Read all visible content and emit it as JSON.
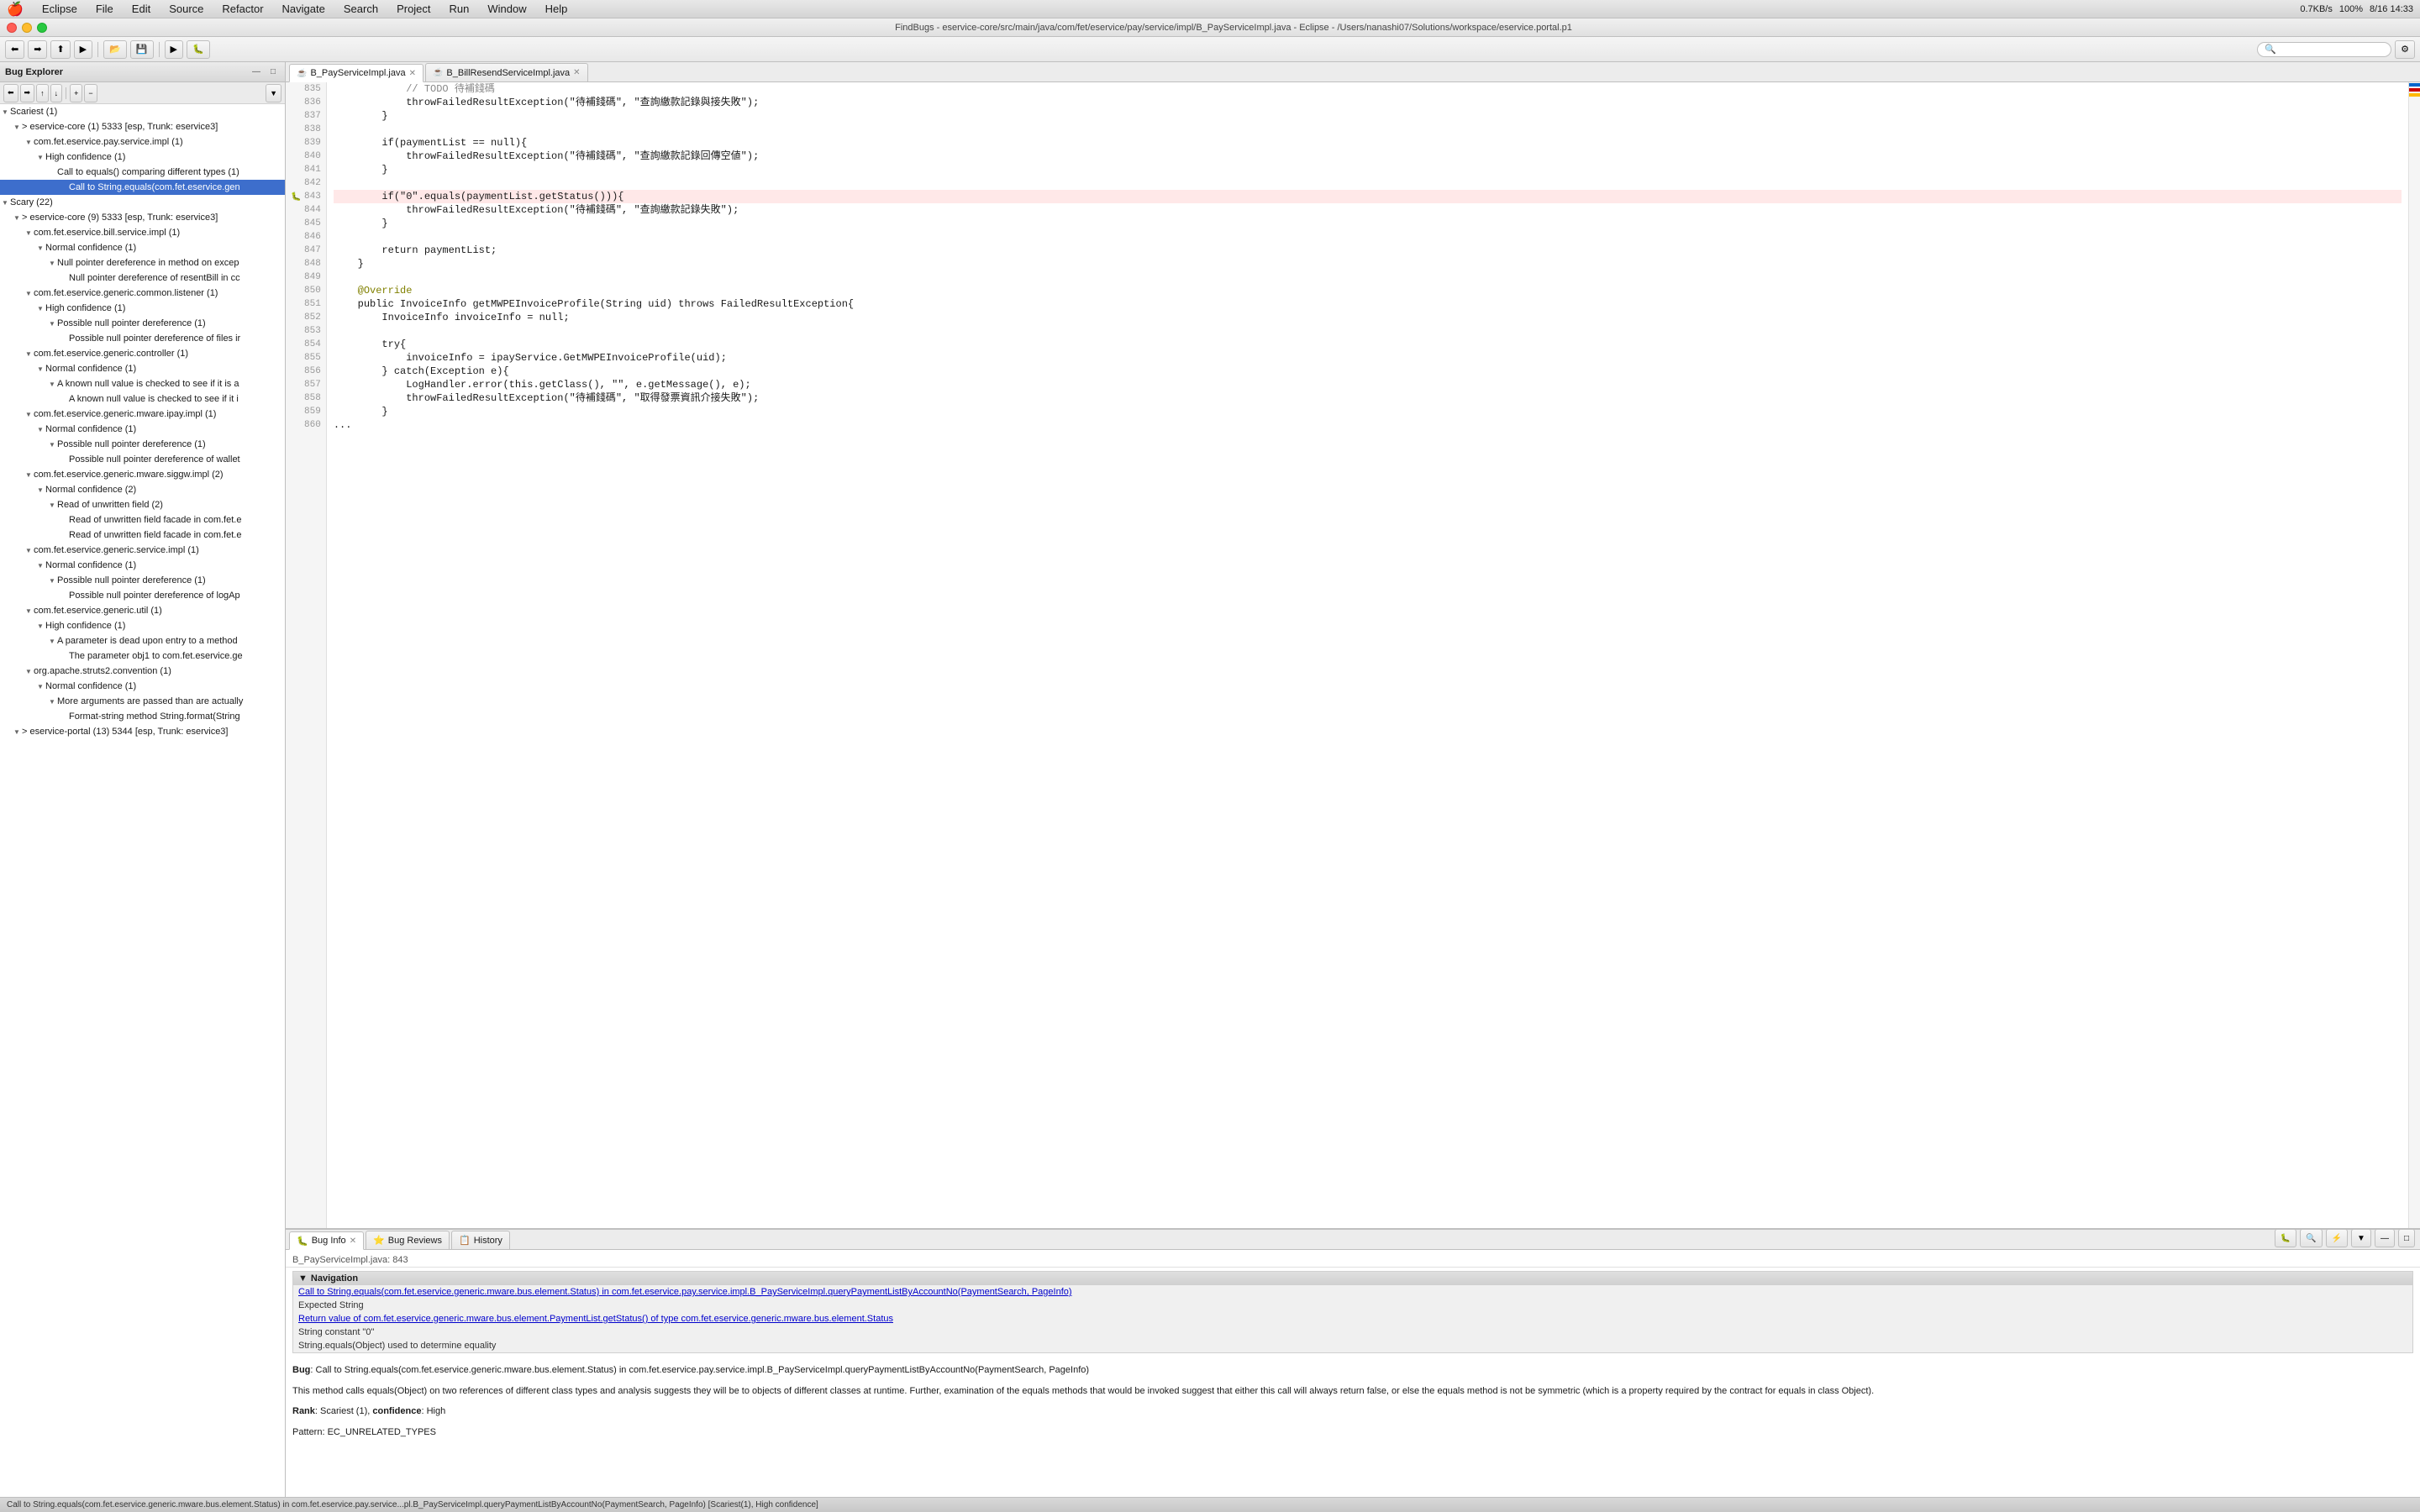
{
  "menubar": {
    "apple": "🍎",
    "items": [
      "Eclipse",
      "File",
      "Edit",
      "Source",
      "Refactor",
      "Navigate",
      "Search",
      "Project",
      "Run",
      "Window",
      "Help"
    ],
    "right_items": [
      "0.7KB/s",
      "100%",
      "8/16 14:33"
    ]
  },
  "titlebar": {
    "text": "FindBugs - eservice-core/src/main/java/com/fet/eservice/pay/service/impl/B_PayServiceImpl.java - Eclipse - /Users/nanashi07/Solutions/workspace/eservice.portal.p1"
  },
  "left_panel": {
    "title": "Bug Explorer",
    "tree": [
      {
        "level": 0,
        "arrow": "▼",
        "icon": "⚠️",
        "label": "Scariest (1)",
        "type": "category"
      },
      {
        "level": 1,
        "arrow": "▼",
        "icon": "📁",
        "label": "> eservice-core (1) 5333 [esp, Trunk: eservice3]",
        "type": "project"
      },
      {
        "level": 2,
        "arrow": "▼",
        "icon": "📦",
        "label": "com.fet.eservice.pay.service.impl (1)",
        "type": "package"
      },
      {
        "level": 3,
        "arrow": "▼",
        "icon": "⚡",
        "label": "High confidence (1)",
        "type": "confidence"
      },
      {
        "level": 4,
        "arrow": "",
        "icon": "🐛",
        "label": "Call to equals() comparing different types (1)",
        "type": "bug"
      },
      {
        "level": 5,
        "arrow": "",
        "icon": "🐛",
        "label": "Call to String.equals(com.fet.eservice.gen",
        "type": "bug",
        "selected": true
      },
      {
        "level": 0,
        "arrow": "▼",
        "icon": "😱",
        "label": "Scary (22)",
        "type": "category"
      },
      {
        "level": 1,
        "arrow": "▼",
        "icon": "📁",
        "label": "> eservice-core (9) 5333 [esp, Trunk: eservice3]",
        "type": "project"
      },
      {
        "level": 2,
        "arrow": "▼",
        "icon": "📦",
        "label": "com.fet.eservice.bill.service.impl (1)",
        "type": "package"
      },
      {
        "level": 3,
        "arrow": "▼",
        "icon": "⚡",
        "label": "Normal confidence (1)",
        "type": "confidence"
      },
      {
        "level": 4,
        "arrow": "▼",
        "icon": "🐛",
        "label": "Null pointer dereference in method on excep",
        "type": "bug"
      },
      {
        "level": 5,
        "arrow": "",
        "icon": "🐛",
        "label": "Null pointer dereference of resentBill in cc",
        "type": "bug"
      },
      {
        "level": 2,
        "arrow": "▼",
        "icon": "📦",
        "label": "com.fet.eservice.generic.common.listener (1)",
        "type": "package"
      },
      {
        "level": 3,
        "arrow": "▼",
        "icon": "⚡",
        "label": "High confidence (1)",
        "type": "confidence"
      },
      {
        "level": 4,
        "arrow": "▼",
        "icon": "🐛",
        "label": "Possible null pointer dereference (1)",
        "type": "bug"
      },
      {
        "level": 5,
        "arrow": "",
        "icon": "🐛",
        "label": "Possible null pointer dereference of files ir",
        "type": "bug"
      },
      {
        "level": 2,
        "arrow": "▼",
        "icon": "📦",
        "label": "com.fet.eservice.generic.controller (1)",
        "type": "package"
      },
      {
        "level": 3,
        "arrow": "▼",
        "icon": "⚡",
        "label": "Normal confidence (1)",
        "type": "confidence"
      },
      {
        "level": 4,
        "arrow": "▼",
        "icon": "🐛",
        "label": "A known null value is checked to see if it is a",
        "type": "bug"
      },
      {
        "level": 5,
        "arrow": "",
        "icon": "🐛",
        "label": "A known null value is checked to see if it i",
        "type": "bug"
      },
      {
        "level": 2,
        "arrow": "▼",
        "icon": "📦",
        "label": "com.fet.eservice.generic.mware.ipay.impl (1)",
        "type": "package"
      },
      {
        "level": 3,
        "arrow": "▼",
        "icon": "⚡",
        "label": "Normal confidence (1)",
        "type": "confidence"
      },
      {
        "level": 4,
        "arrow": "▼",
        "icon": "🐛",
        "label": "Possible null pointer dereference (1)",
        "type": "bug"
      },
      {
        "level": 5,
        "arrow": "",
        "icon": "🐛",
        "label": "Possible null pointer dereference of wallet",
        "type": "bug"
      },
      {
        "level": 2,
        "arrow": "▼",
        "icon": "📦",
        "label": "com.fet.eservice.generic.mware.siggw.impl (2)",
        "type": "package"
      },
      {
        "level": 3,
        "arrow": "▼",
        "icon": "⚡",
        "label": "Normal confidence (2)",
        "type": "confidence"
      },
      {
        "level": 4,
        "arrow": "▼",
        "icon": "🐛",
        "label": "Read of unwritten field (2)",
        "type": "bug"
      },
      {
        "level": 5,
        "arrow": "",
        "icon": "🐛",
        "label": "Read of unwritten field facade in com.fet.e",
        "type": "bug"
      },
      {
        "level": 5,
        "arrow": "",
        "icon": "🐛",
        "label": "Read of unwritten field facade in com.fet.e",
        "type": "bug"
      },
      {
        "level": 2,
        "arrow": "▼",
        "icon": "📦",
        "label": "com.fet.eservice.generic.service.impl (1)",
        "type": "package"
      },
      {
        "level": 3,
        "arrow": "▼",
        "icon": "⚡",
        "label": "Normal confidence (1)",
        "type": "confidence"
      },
      {
        "level": 4,
        "arrow": "▼",
        "icon": "🐛",
        "label": "Possible null pointer dereference (1)",
        "type": "bug"
      },
      {
        "level": 5,
        "arrow": "",
        "icon": "🐛",
        "label": "Possible null pointer dereference of logAp",
        "type": "bug"
      },
      {
        "level": 2,
        "arrow": "▼",
        "icon": "📦",
        "label": "com.fet.eservice.generic.util (1)",
        "type": "package"
      },
      {
        "level": 3,
        "arrow": "▼",
        "icon": "⚡",
        "label": "High confidence (1)",
        "type": "confidence"
      },
      {
        "level": 4,
        "arrow": "▼",
        "icon": "🐛",
        "label": "A parameter is dead upon entry to a method",
        "type": "bug"
      },
      {
        "level": 5,
        "arrow": "",
        "icon": "🐛",
        "label": "The parameter obj1 to com.fet.eservice.ge",
        "type": "bug"
      },
      {
        "level": 2,
        "arrow": "▼",
        "icon": "📦",
        "label": "org.apache.struts2.convention (1)",
        "type": "package"
      },
      {
        "level": 3,
        "arrow": "▼",
        "icon": "⚡",
        "label": "Normal confidence (1)",
        "type": "confidence"
      },
      {
        "level": 4,
        "arrow": "▼",
        "icon": "🐛",
        "label": "More arguments are passed than are actually",
        "type": "bug"
      },
      {
        "level": 5,
        "arrow": "",
        "icon": "🐛",
        "label": "Format-string method String.format(String",
        "type": "bug"
      },
      {
        "level": 1,
        "arrow": "▼",
        "icon": "📁",
        "label": "> eservice-portal (13) 5344 [esp, Trunk: eservice3]",
        "type": "project"
      }
    ]
  },
  "editor": {
    "tabs": [
      {
        "label": "B_PayServiceImpl.java",
        "active": true,
        "dirty": false
      },
      {
        "label": "B_BillResendServiceImpl.java",
        "active": false,
        "dirty": false
      }
    ],
    "lines": [
      {
        "num": 835,
        "content": "            // TODO 待補錢碼",
        "type": "comment"
      },
      {
        "num": 836,
        "content": "            throwFailedResultException(\"待補錢碼\", \"查詢繳款記錄與接失敗\");",
        "type": "normal"
      },
      {
        "num": 837,
        "content": "        }",
        "type": "normal"
      },
      {
        "num": 838,
        "content": "",
        "type": "normal"
      },
      {
        "num": 839,
        "content": "        if(paymentList == null){",
        "type": "normal"
      },
      {
        "num": 840,
        "content": "            throwFailedResultException(\"待補錢碼\", \"查詢繳款記錄回傳空値\");",
        "type": "normal"
      },
      {
        "num": 841,
        "content": "        }",
        "type": "normal"
      },
      {
        "num": 842,
        "content": "",
        "type": "normal"
      },
      {
        "num": 843,
        "content": "        if(\"0\".equals(paymentList.getStatus())){",
        "type": "bug"
      },
      {
        "num": 844,
        "content": "            throwFailedResultException(\"待補錢碼\", \"查詢繳款記錄失敗\");",
        "type": "normal"
      },
      {
        "num": 845,
        "content": "        }",
        "type": "normal"
      },
      {
        "num": 846,
        "content": "",
        "type": "normal"
      },
      {
        "num": 847,
        "content": "        return paymentList;",
        "type": "normal"
      },
      {
        "num": 848,
        "content": "    }",
        "type": "normal"
      },
      {
        "num": 849,
        "content": "",
        "type": "normal"
      },
      {
        "num": 850,
        "content": "    @Override",
        "type": "annotation"
      },
      {
        "num": 851,
        "content": "    public InvoiceInfo getMWPEInvoiceProfile(String uid) throws FailedResultException{",
        "type": "normal"
      },
      {
        "num": 852,
        "content": "        InvoiceInfo invoiceInfo = null;",
        "type": "normal"
      },
      {
        "num": 853,
        "content": "",
        "type": "normal"
      },
      {
        "num": 854,
        "content": "        try{",
        "type": "normal"
      },
      {
        "num": 855,
        "content": "            invoiceInfo = ipayService.GetMWPEInvoiceProfile(uid);",
        "type": "normal"
      },
      {
        "num": 856,
        "content": "        } catch(Exception e){",
        "type": "normal"
      },
      {
        "num": 857,
        "content": "            LogHandler.error(this.getClass(), \"\", e.getMessage(), e);",
        "type": "normal"
      },
      {
        "num": 858,
        "content": "            throwFailedResultException(\"待補錢碼\", \"取得發票資訊介接失敗\");",
        "type": "normal"
      },
      {
        "num": 859,
        "content": "        }",
        "type": "normal"
      },
      {
        "num": 860,
        "content": "...",
        "type": "normal"
      }
    ]
  },
  "bottom_panel": {
    "tabs": [
      {
        "label": "Bug Info",
        "active": true,
        "icon": "🐛"
      },
      {
        "label": "Bug Reviews",
        "active": false,
        "icon": "⭐"
      },
      {
        "label": "History",
        "active": false,
        "icon": "📋"
      }
    ],
    "file_location": "B_PayServiceImpl.java: 843",
    "navigation_items": [
      "Call to String.equals(com.fet.eservice.generic.mware.bus.element.Status) in com.fet.eservice.pay.service.impl.B_PayServiceImpl.queryPaymentListByAccountNo(PaymentSearch, PageInfo)",
      "Expected String",
      "Return value of com.fet.eservice.generic.mware.bus.element.PaymentList.getStatus() of type com.fet.eservice.generic.mware.bus.element.Status",
      "String constant \"0\"",
      "String.equals(Object) used to determine equality"
    ],
    "bug_title": "Bug: Call to String.equals(com.fet.eservice.generic.mware.bus.element.Status) in com.fet.eservice.pay.service.impl.B_PayServiceImpl.queryPaymentListByAccountNo(PaymentSearch, PageInfo)",
    "bug_description": "This method calls equals(Object) on two references of different class types and analysis suggests they will be to objects of different classes at runtime. Further, examination of the equals methods that would be invoked suggest that either this call will always return false, or else the equals method is not be symmetric (which is a property required by the contract for equals in class Object).",
    "rank_line": "Rank: Scariest (1), confidence: High",
    "pattern_line": "Pattern: EC_UNRELATED_TYPES"
  },
  "status_bar": {
    "text": "Call to String.equals(com.fet.eservice.generic.mware.bus.element.Status) in com.fet.eservice.pay.service...pl.B_PayServiceImpl.queryPaymentListByAccountNo(PaymentSearch, PageInfo) [Scariest(1), High confidence]"
  }
}
